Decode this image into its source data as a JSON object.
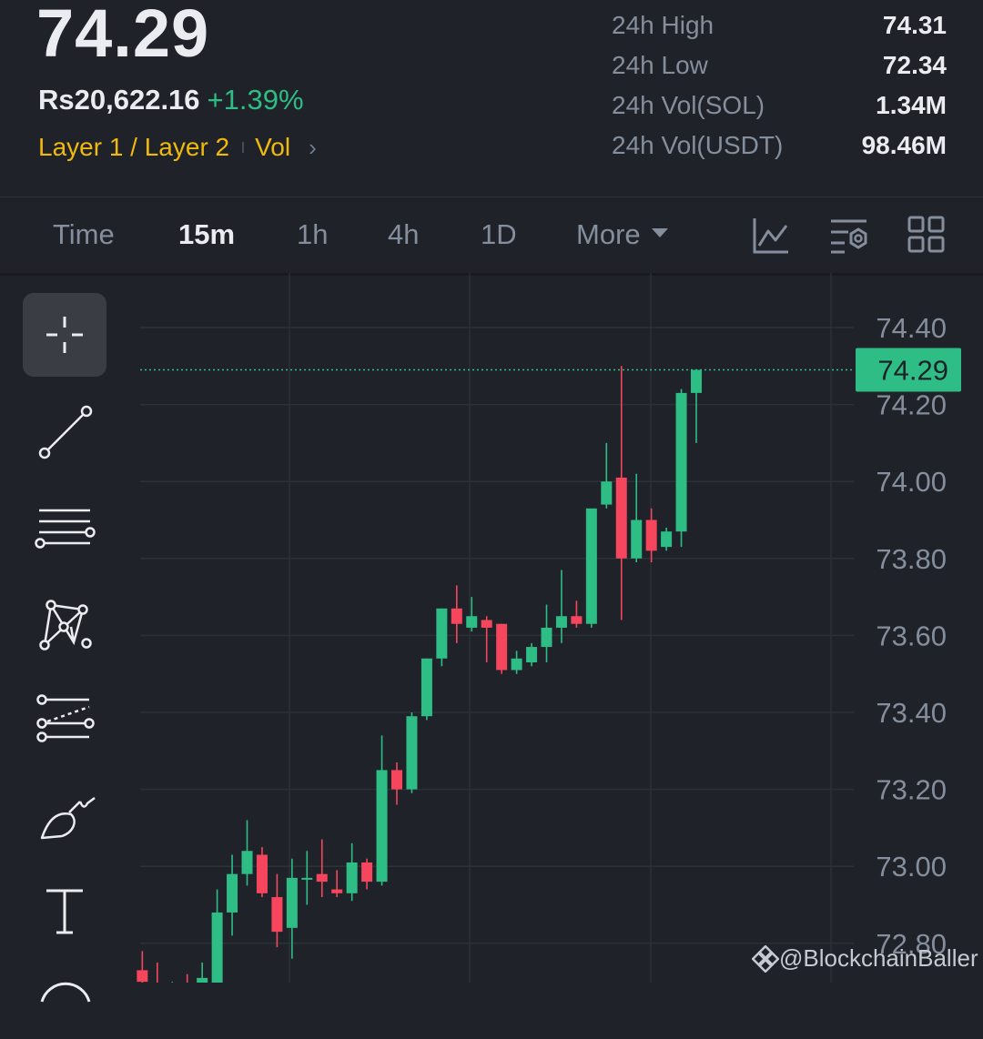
{
  "header": {
    "last_price": "74.29",
    "fiat_value": "Rs20,622.16",
    "change_pct": "+1.39%",
    "tag": "Layer 1 / Layer 2",
    "vol_tag": "Vol",
    "chevron": "›"
  },
  "stats": [
    {
      "label": "24h High",
      "value": "74.31"
    },
    {
      "label": "24h Low",
      "value": "72.34"
    },
    {
      "label": "24h Vol(SOL)",
      "value": "1.34M"
    },
    {
      "label": "24h Vol(USDT)",
      "value": "98.46M"
    }
  ],
  "intervals": {
    "time": "Time",
    "m15": "15m",
    "h1": "1h",
    "h4": "4h",
    "d1": "1D",
    "more": "More",
    "active": "15m"
  },
  "toolbar_icons": [
    "chart-line-icon",
    "indicator-settings-icon",
    "layout-grid-icon"
  ],
  "drawing_tools": [
    "crosshair-icon",
    "trend-line-icon",
    "horizontal-lines-icon",
    "pattern-icon",
    "fibonacci-icon",
    "brush-icon",
    "text-icon",
    "more-tools-icon"
  ],
  "colors": {
    "up": "#2ebd85",
    "down": "#f6465d",
    "background": "#1f2329",
    "accent": "#f0b90b",
    "grid": "#2b3139"
  },
  "watermark": "@BlockchainBaller",
  "chart_data": {
    "type": "candlestick",
    "interval": "15m",
    "y_ticks": [
      "74.40",
      "74.20",
      "74.00",
      "73.80",
      "73.60",
      "73.40",
      "73.20",
      "73.00",
      "72.80"
    ],
    "ylim": [
      72.7,
      74.53
    ],
    "current_price": "74.29",
    "current_price_value": 74.29,
    "candles": [
      {
        "o": 72.73,
        "h": 72.78,
        "l": 72.66,
        "c": 72.7
      },
      {
        "o": 72.68,
        "h": 72.75,
        "l": 72.6,
        "c": 72.65
      },
      {
        "o": 72.63,
        "h": 72.7,
        "l": 72.55,
        "c": 72.67
      },
      {
        "o": 72.67,
        "h": 72.72,
        "l": 72.58,
        "c": 72.64
      },
      {
        "o": 72.64,
        "h": 72.75,
        "l": 72.6,
        "c": 72.71
      },
      {
        "o": 72.68,
        "h": 72.94,
        "l": 72.6,
        "c": 72.88
      },
      {
        "o": 72.88,
        "h": 73.03,
        "l": 72.82,
        "c": 72.98
      },
      {
        "o": 72.98,
        "h": 73.12,
        "l": 72.95,
        "c": 73.04
      },
      {
        "o": 73.03,
        "h": 73.05,
        "l": 72.92,
        "c": 72.93
      },
      {
        "o": 72.92,
        "h": 72.98,
        "l": 72.79,
        "c": 72.83
      },
      {
        "o": 72.84,
        "h": 73.02,
        "l": 72.76,
        "c": 72.97
      },
      {
        "o": 72.97,
        "h": 73.04,
        "l": 72.9,
        "c": 72.97
      },
      {
        "o": 72.98,
        "h": 73.07,
        "l": 72.92,
        "c": 72.96
      },
      {
        "o": 72.94,
        "h": 72.99,
        "l": 72.92,
        "c": 72.93
      },
      {
        "o": 72.93,
        "h": 73.06,
        "l": 72.91,
        "c": 73.01
      },
      {
        "o": 73.01,
        "h": 73.02,
        "l": 72.94,
        "c": 72.96
      },
      {
        "o": 72.96,
        "h": 73.34,
        "l": 72.95,
        "c": 73.25
      },
      {
        "o": 73.25,
        "h": 73.27,
        "l": 73.16,
        "c": 73.2
      },
      {
        "o": 73.2,
        "h": 73.4,
        "l": 73.19,
        "c": 73.39
      },
      {
        "o": 73.39,
        "h": 73.54,
        "l": 73.38,
        "c": 73.54
      },
      {
        "o": 73.54,
        "h": 73.67,
        "l": 73.52,
        "c": 73.67
      },
      {
        "o": 73.67,
        "h": 73.73,
        "l": 73.58,
        "c": 73.63
      },
      {
        "o": 73.62,
        "h": 73.7,
        "l": 73.61,
        "c": 73.65
      },
      {
        "o": 73.64,
        "h": 73.65,
        "l": 73.53,
        "c": 73.62
      },
      {
        "o": 73.63,
        "h": 73.63,
        "l": 73.5,
        "c": 73.51
      },
      {
        "o": 73.51,
        "h": 73.56,
        "l": 73.5,
        "c": 73.54
      },
      {
        "o": 73.53,
        "h": 73.58,
        "l": 73.52,
        "c": 73.57
      },
      {
        "o": 73.57,
        "h": 73.68,
        "l": 73.53,
        "c": 73.62
      },
      {
        "o": 73.62,
        "h": 73.77,
        "l": 73.58,
        "c": 73.65
      },
      {
        "o": 73.65,
        "h": 73.69,
        "l": 73.62,
        "c": 73.63
      },
      {
        "o": 73.63,
        "h": 73.9,
        "l": 73.62,
        "c": 73.93
      },
      {
        "o": 73.94,
        "h": 74.1,
        "l": 73.93,
        "c": 74.0
      },
      {
        "o": 74.01,
        "h": 74.3,
        "l": 73.64,
        "c": 73.8
      },
      {
        "o": 73.8,
        "h": 74.02,
        "l": 73.79,
        "c": 73.9
      },
      {
        "o": 73.9,
        "h": 73.93,
        "l": 73.79,
        "c": 73.82
      },
      {
        "o": 73.83,
        "h": 73.88,
        "l": 73.82,
        "c": 73.87
      },
      {
        "o": 73.87,
        "h": 74.24,
        "l": 73.83,
        "c": 74.23
      },
      {
        "o": 74.23,
        "h": 74.29,
        "l": 74.1,
        "c": 74.29
      }
    ]
  }
}
